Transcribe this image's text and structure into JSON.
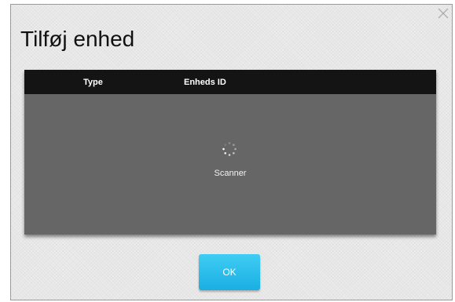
{
  "dialog": {
    "title": "Tilføj enhed",
    "close_icon": "close-icon"
  },
  "table": {
    "columns": [
      "Type",
      "Enheds ID"
    ],
    "status_text": "Scanner",
    "spinner_icon": "loading-spinner-icon"
  },
  "actions": {
    "ok_label": "OK"
  },
  "colors": {
    "panel_background": "#666666",
    "header_background": "#141414",
    "ok_button": "#1aaee2"
  }
}
